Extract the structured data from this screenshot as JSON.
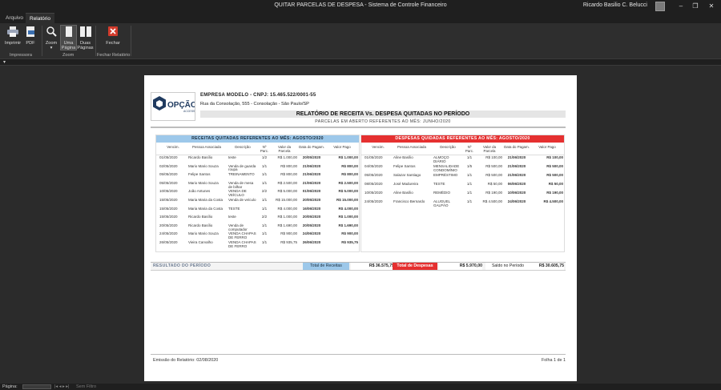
{
  "window": {
    "title": "QUITAR PARCELAS DE DESPESA  -  Sistema de Controle Financeiro",
    "user": "Ricardo Basilio C. Belucci",
    "minimize": "–",
    "maximize": "❐",
    "close": "✕"
  },
  "tabs": [
    {
      "label": "Arquivo"
    },
    {
      "label": "Relatório"
    }
  ],
  "ribbon": {
    "print_label": "Imprimir",
    "pdf_label": "PDF",
    "zoom_label": "Zoom",
    "zoom_arrow": "▾",
    "one_page_label": [
      "Uma",
      "Página"
    ],
    "two_pages_label": [
      "Duas",
      "Páginas"
    ],
    "close_report_label": [
      "Fechar"
    ],
    "groups": {
      "printer": "Impressora",
      "zoom": "Zoom",
      "close": "Fechar Relatório"
    }
  },
  "qat": {
    "arrow": "▾"
  },
  "report": {
    "company": "EMPRESA MODELO - CNPJ: 15.465.522/0001-55",
    "address": "Rua da Consolação, 555 - Consolação - São Paulo/SP",
    "title": "RELATÓRIO DE RECEITA Vs. DESPESA QUITADAS NO PERÍODO",
    "subtitle": "PARCELAS EM ABERTO REFERENTES AO MÊS: JUNHO/2020",
    "logo_text": "OPÇÃO",
    "logo_sub": "ACCESS",
    "receitas": {
      "header": "RECEITAS QUITADAS REFERENTES AO MÊS: AGOSTO/2020",
      "columns": [
        "Vencim.",
        "Pessoa Associada",
        "Descrição",
        "Nº Parc.",
        "Valor da Parcela",
        "Data do Pagam.",
        "Valor Pago"
      ],
      "rows": [
        [
          "01/05/2020",
          "Ricardo Basílio",
          "teste",
          "1/2",
          "R$ 1.000,00",
          "20/05/2020",
          "R$ 1.000,00"
        ],
        [
          "02/05/2020",
          "Mario Mario Souza",
          "Venda de guarda roupa",
          "1/1",
          "R$ 800,00",
          "21/06/2020",
          "R$ 800,00"
        ],
        [
          "05/05/2020",
          "Felipe Santos",
          "TREINAMENTO",
          "1/1",
          "R$ 800,00",
          "21/06/2020",
          "R$ 800,00"
        ],
        [
          "05/05/2020",
          "Mario Mario Souza",
          "Venda de mesa de bilhar",
          "1/1",
          "R$ 2.500,00",
          "21/06/2020",
          "R$ 2.500,00"
        ],
        [
          "10/05/2020",
          "João Antunes",
          "VENDA DE VEÍCULO",
          "2/2",
          "R$ 5.000,00",
          "01/06/2020",
          "R$ 5.000,00"
        ],
        [
          "15/05/2020",
          "Maria Maria da Costa",
          "Venda de veículo",
          "1/1",
          "R$ 15.000,00",
          "20/05/2020",
          "R$ 15.000,00"
        ],
        [
          "15/05/2020",
          "Maria Maria da Costa",
          "TESTE",
          "1/1",
          "R$ 4.000,00",
          "16/06/2020",
          "R$ 4.000,00"
        ],
        [
          "15/05/2020",
          "Ricardo Basílio",
          "teste",
          "2/2",
          "R$ 1.000,00",
          "20/05/2020",
          "R$ 1.000,00"
        ],
        [
          "20/05/2020",
          "Ricardo Basílio",
          "Venda de computador",
          "1/1",
          "R$ 1.690,00",
          "20/05/2020",
          "R$ 1.690,00"
        ],
        [
          "24/05/2020",
          "Mario Mario Souza",
          "VENDA CHAPAS DE FERRO",
          "1/1",
          "R$ 900,00",
          "24/06/2020",
          "R$ 900,00"
        ],
        [
          "26/05/2020",
          "Vieira Carvalho",
          "VENDA CHAPAS DE FERRO",
          "1/1",
          "R$ 935,75",
          "26/06/2020",
          "R$ 935,75"
        ]
      ]
    },
    "despesas": {
      "header": "DESPESAS QUIDADAS REFERENTES AO MÊS: AGOSTO/2020",
      "columns": [
        "Vencim.",
        "Pessoa Associada",
        "Descrição",
        "Nº Parc.",
        "Valor da Parcela",
        "Data do Pagam.",
        "Valor Pago"
      ],
      "rows": [
        [
          "01/05/2020",
          "Aline Basílio",
          "ALMOÇO DIÁRIO",
          "1/1",
          "R$ 100,00",
          "21/06/2020",
          "R$ 100,00"
        ],
        [
          "04/05/2020",
          "Felipe Santos",
          "MENSALIDADE CONDOMÍNIO",
          "1/5",
          "R$ 500,00",
          "21/06/2020",
          "R$ 500,00"
        ],
        [
          "05/05/2020",
          "Salazar Santiago",
          "EMPRÉSTIMO",
          "1/1",
          "R$ 500,00",
          "21/06/2020",
          "R$ 500,00"
        ],
        [
          "08/05/2020",
          "José Madureira",
          "TESTE",
          "1/1",
          "R$ 50,00",
          "06/06/2020",
          "R$ 50,00"
        ],
        [
          "10/05/2020",
          "Aline Basílio",
          "REMÉDIO",
          "1/1",
          "R$ 190,00",
          "10/06/2020",
          "R$ 190,00"
        ],
        [
          "24/05/2020",
          "Francisco Bernardo",
          "ALUGUEL GALPÃO",
          "1/1",
          "R$ 4.500,00",
          "24/06/2020",
          "R$ 4.500,00"
        ]
      ]
    },
    "resultado": {
      "label": "RESULTADO DO PERÍODO",
      "total_receitas_label": "Total de Receitas",
      "total_receitas_value": "R$ 36.575,75",
      "total_despesas_label": "Total de Despesas",
      "total_despesas_value": "R$ 5.970,00",
      "saldo_label": "Saldo no Período",
      "saldo_value": "R$ 30.605,75"
    },
    "emissao": "Emissão do Relatório: 02/08/2020",
    "folha": "Folha 1 de 1"
  },
  "statusbar": {
    "label": "Página:",
    "nav": "|◂  ◂  ▸  ▸|",
    "extra": "Sem Filtro"
  },
  "colors": {
    "receitas_header": "#9dc8ea",
    "despesas_header": "#e53030",
    "dark_bg": "#1f1f1f"
  }
}
